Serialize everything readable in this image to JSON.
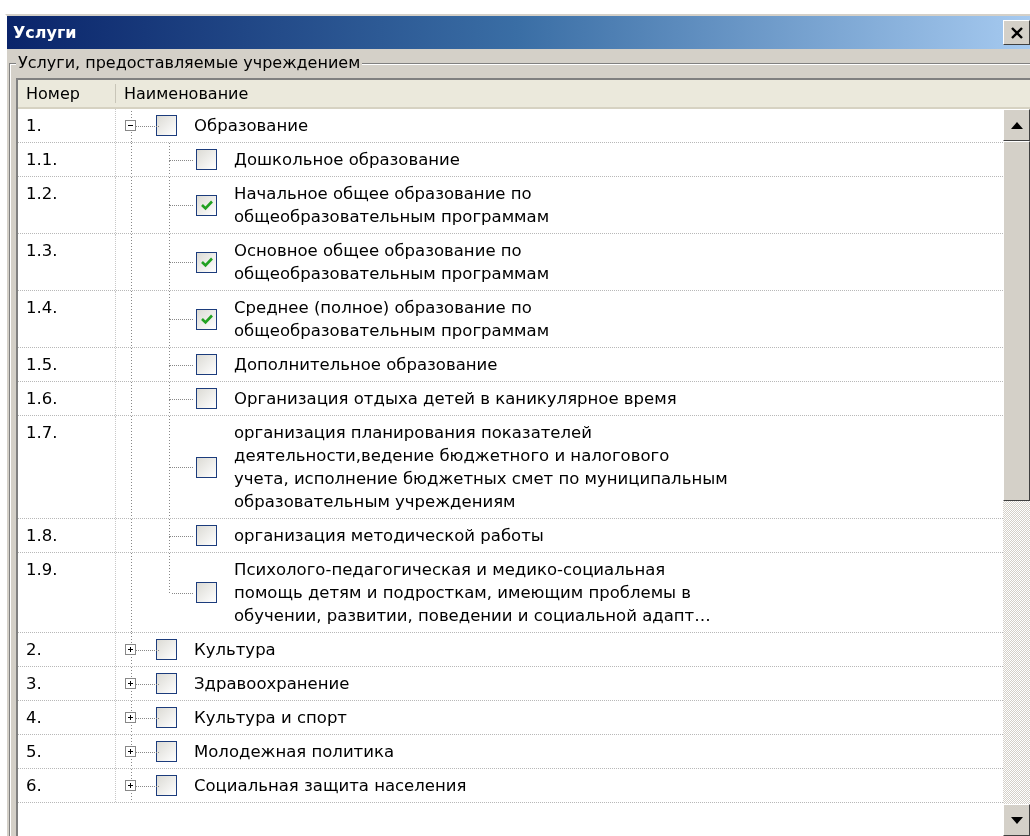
{
  "window": {
    "title": "Услуги"
  },
  "group": {
    "label": "Услуги, предоставляемые учреждением"
  },
  "columns": [
    "Номер",
    "Наименование"
  ],
  "rows": [
    {
      "number": "1.",
      "name": "Образование",
      "checked": false,
      "expanded": true,
      "children": [
        {
          "number": "1.1.",
          "name": "Дошкольное образование",
          "checked": false
        },
        {
          "number": "1.2.",
          "name": "Начальное общее образование по\nобщеобразовательным программам",
          "checked": true
        },
        {
          "number": "1.3.",
          "name": "Основное общее образование по\nобщеобразовательным программам",
          "checked": true
        },
        {
          "number": "1.4.",
          "name": "Среднее (полное) образование по\nобщеобразовательным программам",
          "checked": true
        },
        {
          "number": "1.5.",
          "name": "Дополнительное образование",
          "checked": false
        },
        {
          "number": "1.6.",
          "name": "Организация отдыха детей в каникулярное время",
          "checked": false
        },
        {
          "number": "1.7.",
          "name": "организация планирования показателей\nдеятельности,ведение бюджетного и налогового\nучета, исполнение бюджетных смет по муниципальным\nобразовательным учреждениям",
          "checked": false
        },
        {
          "number": "1.8.",
          "name": "организация методической работы",
          "checked": false
        },
        {
          "number": "1.9.",
          "name": "Психолого-педагогическая и медико-социальная\nпомощь детям и подросткам, имеющим проблемы в\nобучении, развитии, поведении и социальной адапт…",
          "checked": false
        }
      ]
    },
    {
      "number": "2.",
      "name": "Культура",
      "checked": false,
      "expanded": false
    },
    {
      "number": "3.",
      "name": "Здравоохранение",
      "checked": false,
      "expanded": false
    },
    {
      "number": "4.",
      "name": "Культура и спорт",
      "checked": false,
      "expanded": false
    },
    {
      "number": "5.",
      "name": "Молодежная политика",
      "checked": false,
      "expanded": false
    },
    {
      "number": "6.",
      "name": "Социальная защита населения",
      "checked": false,
      "expanded": false
    }
  ]
}
